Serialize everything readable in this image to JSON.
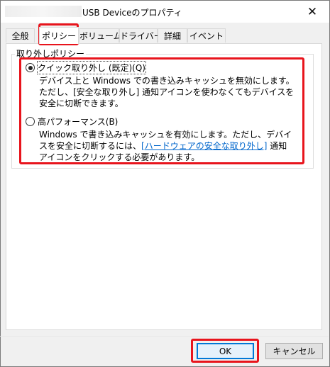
{
  "window": {
    "title": "USB Deviceのプロパティ",
    "close_glyph": "✕"
  },
  "tabs": [
    {
      "label": "全般",
      "active": false
    },
    {
      "label": "ポリシー",
      "active": true
    },
    {
      "label": "ボリューム",
      "active": false
    },
    {
      "label": "ドライバー",
      "active": false
    },
    {
      "label": "詳細",
      "active": false
    },
    {
      "label": "イベント",
      "active": false
    }
  ],
  "policy": {
    "group_label": "取り外しポリシー",
    "options": [
      {
        "label": "クイック取り外し (既定)(Q)",
        "selected": true,
        "description": "デバイス上と Windows での書き込みキャッシュを無効にします。ただし、[安全な取り外し] 通知アイコンを使わなくてもデバイスを安全に切断できます。"
      },
      {
        "label": "高パフォーマンス(B)",
        "selected": false,
        "description_before": "Windows で書き込みキャッシュを有効にします。ただし、デバイスを安全に切断するには、",
        "description_link": "[ハードウェアの安全な取り外し]",
        "description_after": " 通知アイコンをクリックする必要があります。"
      }
    ]
  },
  "buttons": {
    "ok_label": "OK",
    "cancel_label": "キャンセル"
  },
  "colors": {
    "highlight": "#e8141c",
    "link": "#0066cc",
    "default_button_border": "#0078d7"
  }
}
